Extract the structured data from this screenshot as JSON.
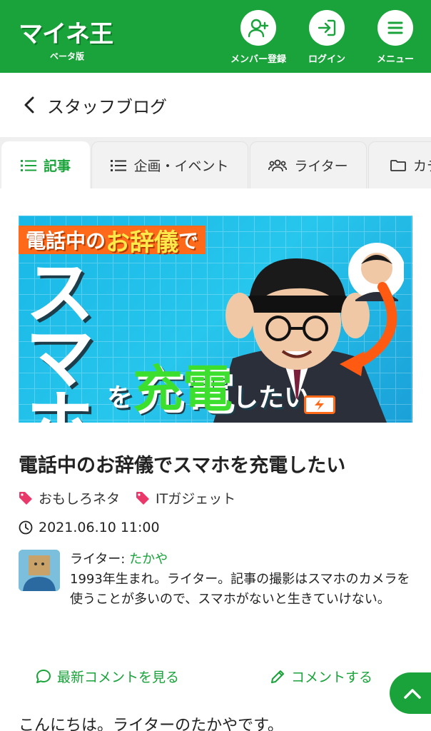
{
  "header": {
    "logo_text": "マイネ王",
    "logo_sub": "ベータ版",
    "register_label": "メンバー登録",
    "login_label": "ログイン",
    "menu_label": "メニュー"
  },
  "page": {
    "back_title": "スタッフブログ"
  },
  "tabs": [
    {
      "label": "記事",
      "active": true
    },
    {
      "label": "企画・イベント"
    },
    {
      "label": "ライター"
    },
    {
      "label": "カテ"
    }
  ],
  "hero": {
    "banner_part1": "電話中の",
    "banner_part2": "お辞儀",
    "banner_part3": "で",
    "big_text": "スマホ",
    "bottom_1": "を",
    "bottom_2": "充電",
    "bottom_3": "したい"
  },
  "article": {
    "title": "電話中のお辞儀でスマホを充電したい",
    "tags": [
      "おもしろネタ",
      "ITガジェット"
    ],
    "date": "2021.06.10 11:00"
  },
  "author": {
    "prefix": "ライター: ",
    "name": "たかや",
    "bio": "1993年生まれ。ライター。記事の撮影はスマホのカメラを使うことが多いので、スマホがないと生きていけない。"
  },
  "actions": {
    "latest_comments": "最新コメントを見る",
    "comment": "コメントする"
  },
  "intro": "こんにちは。ライターのたかやです。",
  "colors": {
    "brand_green": "#19a33a",
    "tag_pink": "#e8396a",
    "hero_orange": "#ff6a1a"
  }
}
